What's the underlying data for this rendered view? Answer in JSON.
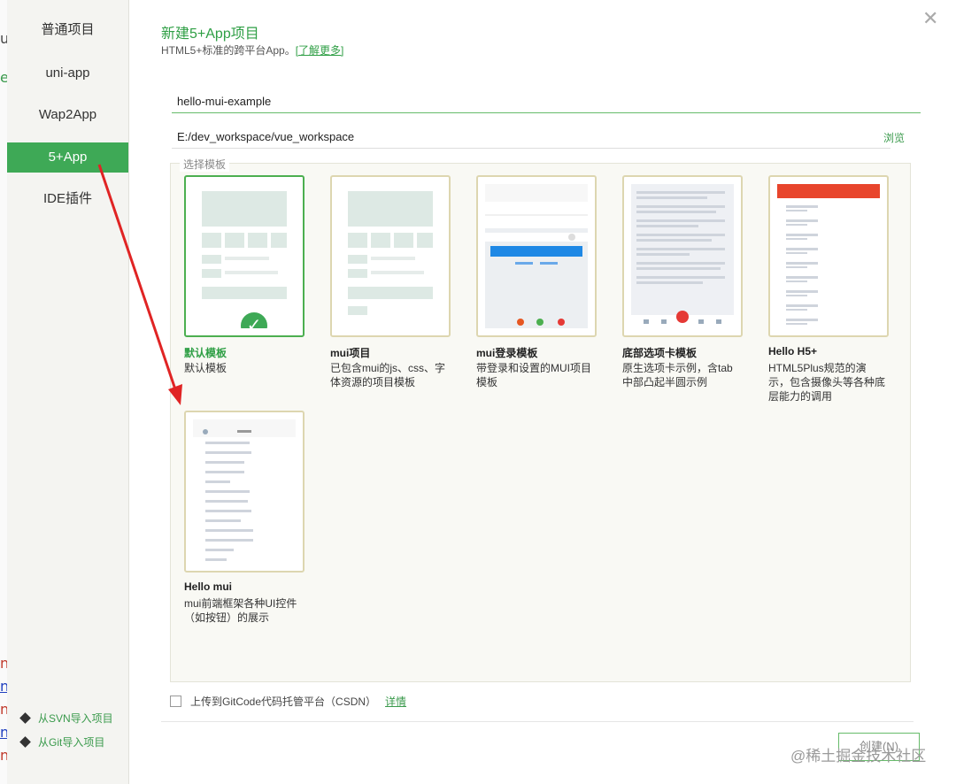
{
  "background_fragments": [
    "u",
    "e",
    "n",
    "n",
    "n",
    "n",
    "n"
  ],
  "sidebar": {
    "items": [
      {
        "label": "普通项目",
        "active": false
      },
      {
        "label": "uni-app",
        "active": false
      },
      {
        "label": "Wap2App",
        "active": false
      },
      {
        "label": "5+App",
        "active": true
      },
      {
        "label": "IDE插件",
        "active": false
      }
    ],
    "import_svn": "从SVN导入项目",
    "import_git": "从Git导入项目"
  },
  "dialog": {
    "title": "新建5+App项目",
    "subtitle": "HTML5+标准的跨平台App。",
    "learn_more": "[了解更多]",
    "project_name": "hello-mui-example",
    "project_path": "E:/dev_workspace/vue_workspace",
    "browse": "浏览",
    "template_legend": "选择模板",
    "templates": [
      {
        "name": "默认模板",
        "desc": "默认模板",
        "selected": true
      },
      {
        "name": "mui项目",
        "desc": "已包含mui的js、css、字体资源的项目模板",
        "selected": false
      },
      {
        "name": "mui登录模板",
        "desc": "带登录和设置的MUI项目模板",
        "selected": false
      },
      {
        "name": "底部选项卡模板",
        "desc": "原生选项卡示例，含tab中部凸起半圆示例",
        "selected": false
      },
      {
        "name": "Hello H5+",
        "desc": "HTML5Plus规范的演示，包含摄像头等各种底层能力的调用",
        "selected": false
      },
      {
        "name": "Hello mui",
        "desc": "mui前端框架各种UI控件（如按钮）的展示",
        "selected": false
      }
    ],
    "upload_label": "上传到GitCode代码托管平台（CSDN）",
    "upload_detail": "详情",
    "create_button": "创建(N)"
  },
  "watermark": "@稀土掘金技术社区",
  "colors": {
    "accent": "#3ea956",
    "arrow": "#e02424",
    "card_border": "#ddd6b0"
  }
}
